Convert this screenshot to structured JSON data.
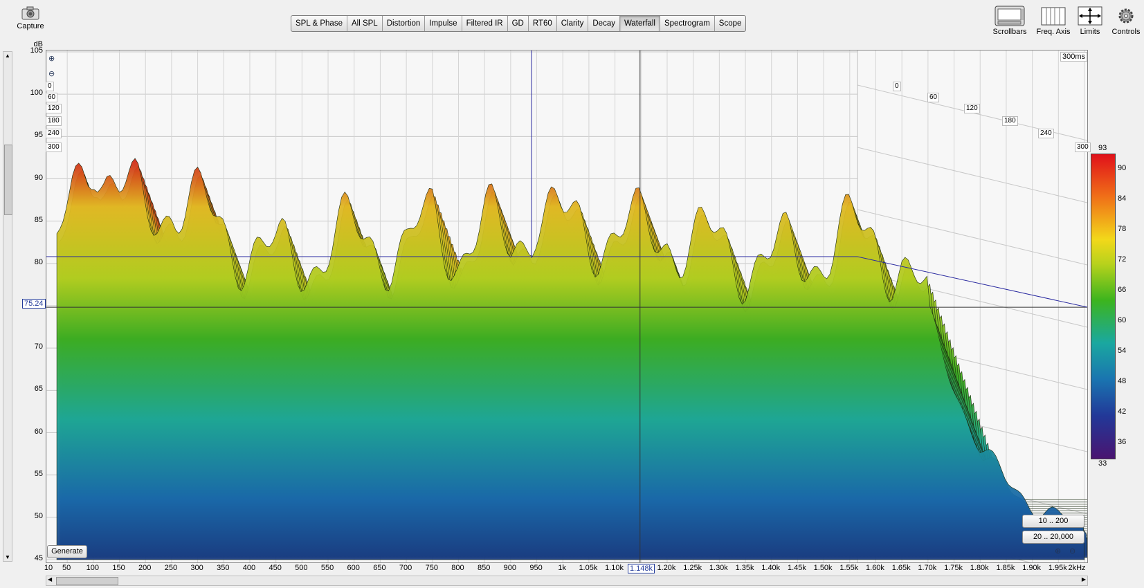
{
  "toolbar_left": {
    "capture_label": "Capture"
  },
  "tabs": [
    {
      "label": "SPL & Phase",
      "active": false
    },
    {
      "label": "All SPL",
      "active": false
    },
    {
      "label": "Distortion",
      "active": false
    },
    {
      "label": "Impulse",
      "active": false
    },
    {
      "label": "Filtered IR",
      "active": false
    },
    {
      "label": "GD",
      "active": false
    },
    {
      "label": "RT60",
      "active": false
    },
    {
      "label": "Clarity",
      "active": false
    },
    {
      "label": "Decay",
      "active": false
    },
    {
      "label": "Waterfall",
      "active": true
    },
    {
      "label": "Spectrogram",
      "active": false
    },
    {
      "label": "Scope",
      "active": false
    }
  ],
  "toolbar_right": {
    "scrollbars_label": "Scrollbars",
    "freq_axis_label": "Freq. Axis",
    "limits_label": "Limits",
    "controls_label": "Controls"
  },
  "plot": {
    "y_unit": "dB",
    "y_ticks": [
      "105",
      "100",
      "95",
      "90",
      "85",
      "80",
      "75",
      "70",
      "65",
      "60",
      "55",
      "50",
      "45"
    ],
    "y_cursor_value": "75.24",
    "x_ticks": [
      "10",
      "50",
      "100",
      "150",
      "200",
      "250",
      "300",
      "350",
      "400",
      "450",
      "500",
      "550",
      "600",
      "650",
      "700",
      "750",
      "800",
      "850",
      "900",
      "950",
      "1k",
      "1.05k",
      "1.10k",
      "1.15k",
      "1.20k",
      "1.25k",
      "1.30k",
      "1.35k",
      "1.40k",
      "1.45k",
      "1.50k",
      "1.55k",
      "1.60k",
      "1.65k",
      "1.70k",
      "1.75k",
      "1.80k",
      "1.85k",
      "1.90k",
      "1.95k",
      "2kHz"
    ],
    "x_cursor_value": "1.148k",
    "time_span_label": "300ms",
    "time_ticks_left": [
      "0",
      "60",
      "120",
      "180",
      "240",
      "300"
    ],
    "time_ticks_right": [
      "0",
      "60",
      "120",
      "180",
      "240",
      "300"
    ],
    "generate_label": "Generate",
    "range_button_1": "10 .. 200",
    "range_button_2": "20 .. 20,000"
  },
  "colorbar": {
    "top_label": "93",
    "bottom_label": "33",
    "ticks": [
      "90",
      "84",
      "78",
      "72",
      "66",
      "60",
      "54",
      "48",
      "42",
      "36"
    ]
  },
  "chart_data": {
    "type": "waterfall",
    "title": "",
    "xlabel": "",
    "ylabel": "dB",
    "xlim": [
      10,
      2000
    ],
    "ylim": [
      45,
      105
    ],
    "zlim_ms": [
      0,
      300
    ],
    "color_scale_db": [
      33,
      93
    ],
    "grid": true,
    "peak_envelope": {
      "x_hz": [
        30,
        60,
        80,
        100,
        120,
        150,
        200,
        250,
        300,
        350,
        400,
        450,
        500,
        550,
        600,
        650,
        700,
        750,
        800,
        850,
        900,
        950,
        1000,
        1050,
        1100,
        1150,
        1200,
        1250,
        1300,
        1350,
        1400,
        1450,
        1500,
        1550,
        1600,
        1650,
        1700,
        1750,
        1800,
        1850,
        1900,
        1950,
        2000
      ],
      "y_db": [
        80,
        88,
        92,
        95,
        91,
        88,
        86,
        88,
        86,
        84,
        82,
        80,
        81,
        82,
        83,
        83,
        81,
        85,
        82,
        84,
        82,
        87,
        84,
        84,
        84,
        83,
        84,
        82,
        82,
        81,
        80,
        81,
        82,
        83,
        83,
        80,
        74,
        66,
        58,
        54,
        52,
        50,
        48
      ]
    }
  }
}
